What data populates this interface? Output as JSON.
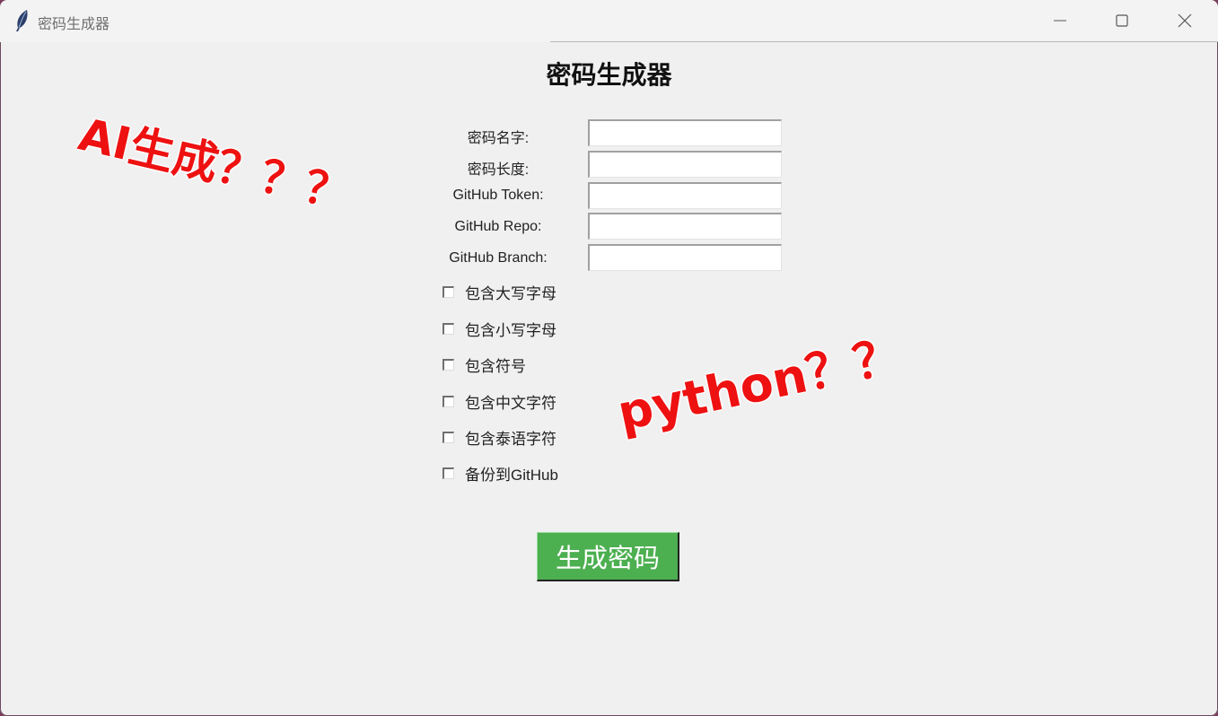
{
  "window": {
    "title": "密码生成器",
    "controls": {
      "minimize": "minimize",
      "maximize": "maximize",
      "close": "close"
    }
  },
  "form": {
    "heading": "密码生成器",
    "fields": [
      {
        "label": "密码名字:",
        "value": ""
      },
      {
        "label": "密码长度:",
        "value": ""
      },
      {
        "label": "GitHub Token:",
        "value": ""
      },
      {
        "label": "GitHub Repo:",
        "value": ""
      },
      {
        "label": "GitHub Branch:",
        "value": ""
      }
    ],
    "checkboxes": [
      {
        "label": "包含大写字母",
        "checked": false
      },
      {
        "label": "包含小写字母",
        "checked": false
      },
      {
        "label": "包含符号",
        "checked": false
      },
      {
        "label": "包含中文字符",
        "checked": false
      },
      {
        "label": "包含泰语字符",
        "checked": false
      },
      {
        "label": "备份到GitHub",
        "checked": false
      }
    ],
    "generate_button": "生成密码"
  },
  "annotations": {
    "ai": "AI生成？？？",
    "python": "python？？"
  },
  "colors": {
    "button_bg": "#4caf50",
    "annotation": "#ee1111",
    "window_bg": "#f0f0f0"
  }
}
